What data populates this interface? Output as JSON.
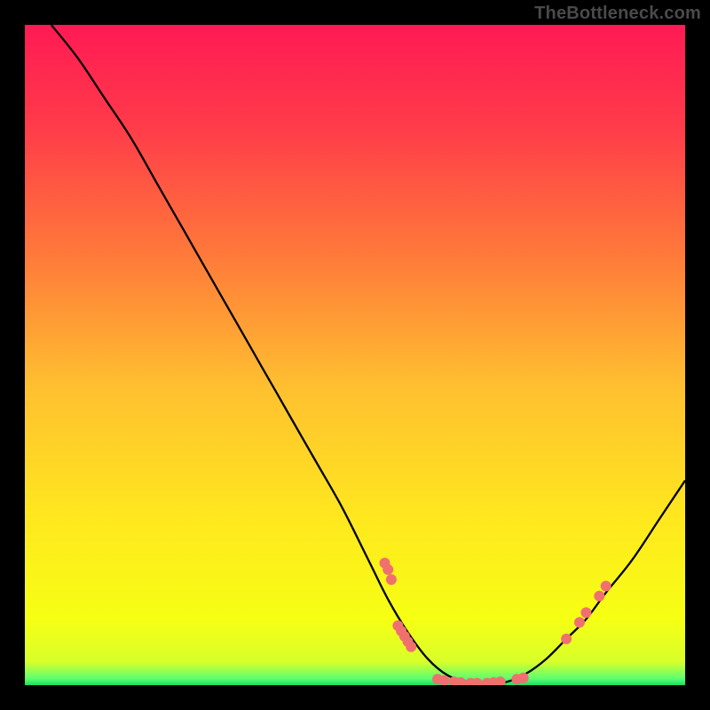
{
  "attribution": "TheBottleneck.com",
  "colors": {
    "background": "#000000",
    "curve": "#000000",
    "marker": "#f07070",
    "gradient_stops": [
      {
        "offset": 0.0,
        "color": "#ff1a54"
      },
      {
        "offset": 0.15,
        "color": "#ff3a4a"
      },
      {
        "offset": 0.35,
        "color": "#ff7a3a"
      },
      {
        "offset": 0.55,
        "color": "#ffc030"
      },
      {
        "offset": 0.75,
        "color": "#ffe81e"
      },
      {
        "offset": 0.9,
        "color": "#f6ff14"
      },
      {
        "offset": 0.965,
        "color": "#d8ff2a"
      },
      {
        "offset": 0.99,
        "color": "#5dff70"
      },
      {
        "offset": 1.0,
        "color": "#18e060"
      }
    ]
  },
  "chart_data": {
    "type": "line",
    "title": "",
    "xlabel": "",
    "ylabel": "",
    "xlim": [
      0,
      100
    ],
    "ylim": [
      0,
      100
    ],
    "curve": [
      {
        "x": 4.0,
        "y": 100.0
      },
      {
        "x": 8.0,
        "y": 95.0
      },
      {
        "x": 12.0,
        "y": 89.0
      },
      {
        "x": 16.0,
        "y": 83.0
      },
      {
        "x": 20.0,
        "y": 76.0
      },
      {
        "x": 24.0,
        "y": 69.0
      },
      {
        "x": 28.0,
        "y": 62.0
      },
      {
        "x": 32.0,
        "y": 55.0
      },
      {
        "x": 36.0,
        "y": 48.0
      },
      {
        "x": 40.0,
        "y": 41.0
      },
      {
        "x": 44.0,
        "y": 34.0
      },
      {
        "x": 48.0,
        "y": 27.0
      },
      {
        "x": 52.0,
        "y": 19.0
      },
      {
        "x": 55.0,
        "y": 13.0
      },
      {
        "x": 58.0,
        "y": 8.0
      },
      {
        "x": 61.0,
        "y": 4.0
      },
      {
        "x": 64.0,
        "y": 1.5
      },
      {
        "x": 67.0,
        "y": 0.5
      },
      {
        "x": 70.0,
        "y": 0.2
      },
      {
        "x": 73.0,
        "y": 0.5
      },
      {
        "x": 76.0,
        "y": 1.8
      },
      {
        "x": 79.0,
        "y": 4.0
      },
      {
        "x": 82.0,
        "y": 7.0
      },
      {
        "x": 85.0,
        "y": 10.0
      },
      {
        "x": 88.0,
        "y": 14.0
      },
      {
        "x": 92.0,
        "y": 19.0
      },
      {
        "x": 96.0,
        "y": 25.0
      },
      {
        "x": 100.0,
        "y": 31.0
      }
    ],
    "markers": [
      {
        "x": 54.5,
        "y": 18.5
      },
      {
        "x": 55.0,
        "y": 17.5
      },
      {
        "x": 55.5,
        "y": 16.0
      },
      {
        "x": 56.5,
        "y": 9.0
      },
      {
        "x": 57.0,
        "y": 8.2
      },
      {
        "x": 57.5,
        "y": 7.4
      },
      {
        "x": 58.0,
        "y": 6.6
      },
      {
        "x": 58.5,
        "y": 5.8
      },
      {
        "x": 62.5,
        "y": 0.9
      },
      {
        "x": 63.5,
        "y": 0.7
      },
      {
        "x": 65.0,
        "y": 0.5
      },
      {
        "x": 66.0,
        "y": 0.4
      },
      {
        "x": 67.5,
        "y": 0.3
      },
      {
        "x": 68.5,
        "y": 0.3
      },
      {
        "x": 70.0,
        "y": 0.3
      },
      {
        "x": 71.0,
        "y": 0.4
      },
      {
        "x": 72.0,
        "y": 0.5
      },
      {
        "x": 74.5,
        "y": 0.9
      },
      {
        "x": 75.5,
        "y": 1.1
      },
      {
        "x": 82.0,
        "y": 7.0
      },
      {
        "x": 84.0,
        "y": 9.5
      },
      {
        "x": 85.0,
        "y": 11.0
      },
      {
        "x": 87.0,
        "y": 13.5
      },
      {
        "x": 88.0,
        "y": 15.0
      }
    ]
  }
}
